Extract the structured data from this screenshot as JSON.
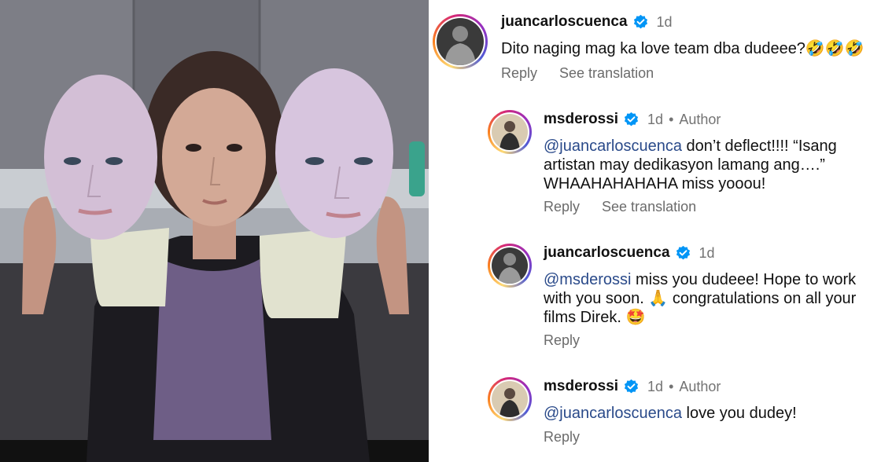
{
  "comments": [
    {
      "username": "juancarloscuenca",
      "time": "1d",
      "text": "Dito naging mag ka love team dba dudeee?🤣🤣🤣",
      "reply_label": "Reply",
      "translate_label": "See translation"
    },
    {
      "username": "msderossi",
      "time": "1d",
      "author_label": "Author",
      "mention": "@juancarloscuenca",
      "line1": " don’t deflect!!!! “Isang",
      "line2": "artistan may dedikasyon lamang ang….”",
      "line3": "WHAAHAHAHAHA miss yooou!",
      "reply_label": "Reply",
      "translate_label": "See translation"
    },
    {
      "username": "juancarloscuenca",
      "time": "1d",
      "mention": "@msderossi",
      "line1": " miss you dudeee! Hope to work",
      "line2": "with you soon. 🙏 congratulations on all your",
      "line3": "films Direk. 🤩",
      "reply_label": "Reply"
    },
    {
      "username": "msderossi",
      "time": "1d",
      "author_label": "Author",
      "mention": "@juancarloscuenca",
      "line1": " love you dudey!",
      "reply_label": "Reply"
    }
  ],
  "separator": "•",
  "colors": {
    "verified_blue": "#0095f6",
    "mention": "#2a4a8a",
    "meta_gray": "#737373"
  },
  "icons": {
    "verified": "verified-badge-icon"
  }
}
